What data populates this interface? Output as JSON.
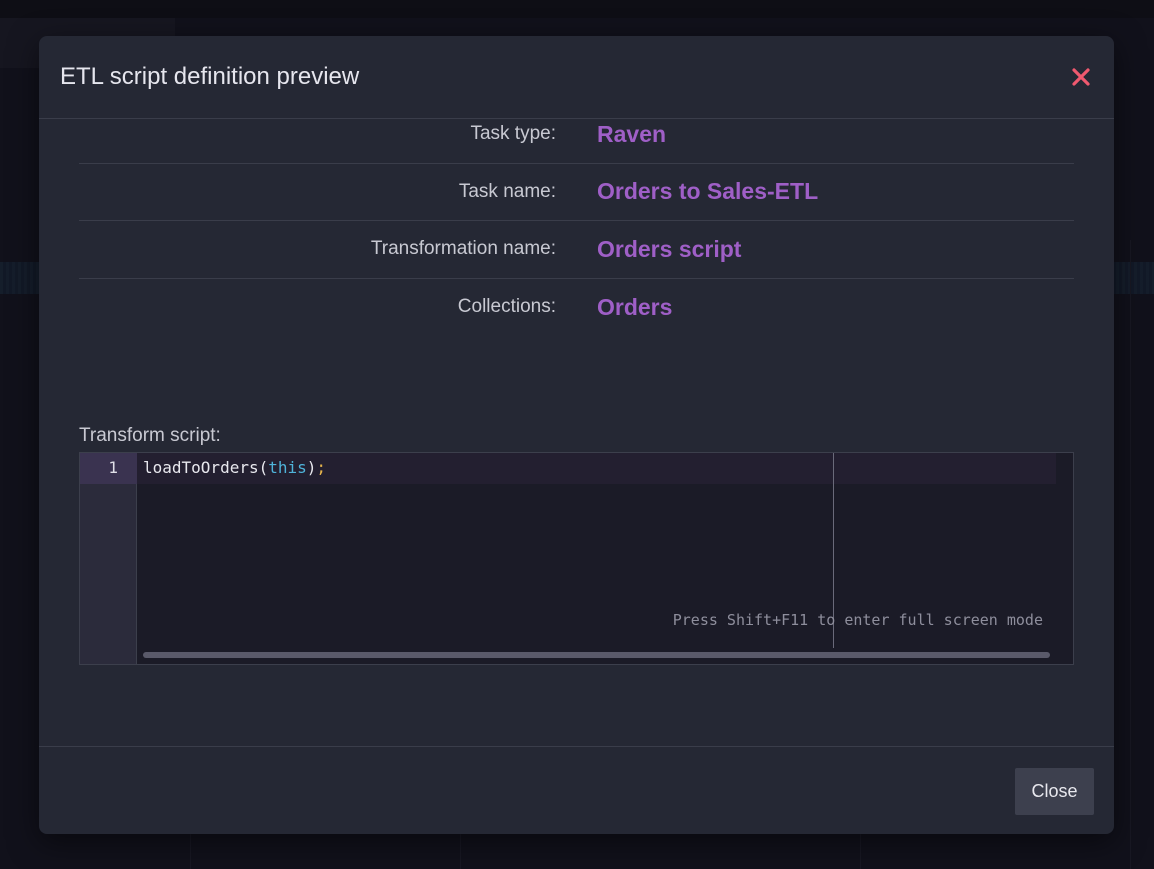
{
  "modal": {
    "title": "ETL script definition preview",
    "close_icon": "close-icon"
  },
  "properties": [
    {
      "label": "Task type:",
      "value": "Raven"
    },
    {
      "label": "Task name:",
      "value": "Orders to Sales-ETL"
    },
    {
      "label": "Transformation name:",
      "value": "Orders script"
    },
    {
      "label": "Collections:",
      "value": "Orders"
    }
  ],
  "script": {
    "label": "Transform script:",
    "line_number": "1",
    "code": {
      "fn": "loadToOrders(",
      "keyword": "this",
      "close": ")",
      "semicolon": ";"
    },
    "hint": "Press Shift+F11 to enter full screen mode"
  },
  "footer": {
    "close_label": "Close"
  },
  "colors": {
    "accent": "#9f5fc7",
    "close_icon": "#f0596f",
    "keyword": "#4fb3d9"
  }
}
